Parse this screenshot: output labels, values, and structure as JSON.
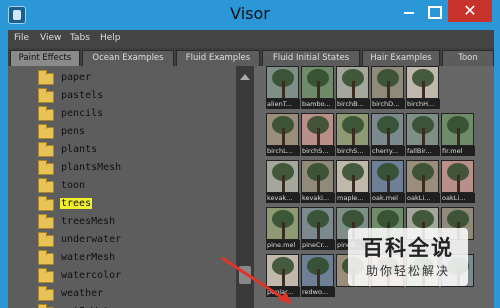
{
  "window": {
    "title": "Visor",
    "close_glyph": "✕"
  },
  "menu": [
    "File",
    "View",
    "Tabs",
    "Help"
  ],
  "tabs": [
    "Paint Effects",
    "Ocean Examples",
    "Fluid Examples",
    "Fluid Initial States",
    "Hair Examples",
    "Toon"
  ],
  "folders": [
    "paper",
    "pastels",
    "pencils",
    "pens",
    "plants",
    "plantsMesh",
    "toon",
    "trees",
    "treesMesh",
    "underwater",
    "waterMesh",
    "watercolor",
    "weather",
    "wetInWet"
  ],
  "selected_folder": "trees",
  "thumbnails": [
    [
      "alienT...",
      "bambo...",
      "birchB...",
      "birchD...",
      "birchH..."
    ],
    [
      "birchL...",
      "birchS...",
      "birchS...",
      "cherry...",
      "fallBir...",
      "fir.mel"
    ],
    [
      "kevak...",
      "kevaki...",
      "maple...",
      "oak.mel",
      "oakLi...",
      "oakLi..."
    ],
    [
      "pine.mel",
      "pineCr...",
      "pineS...",
      "",
      "",
      ""
    ],
    [
      "poplar...",
      "redwo...",
      "",
      "",
      "",
      ""
    ]
  ],
  "watermark": {
    "main": "百科全说",
    "sub": "助你轻松解决"
  },
  "colors": {
    "titlebar": "#2b97d6",
    "selection": "#f2ef2c",
    "folder": "#e9c255",
    "annotation": "#e0342a"
  }
}
